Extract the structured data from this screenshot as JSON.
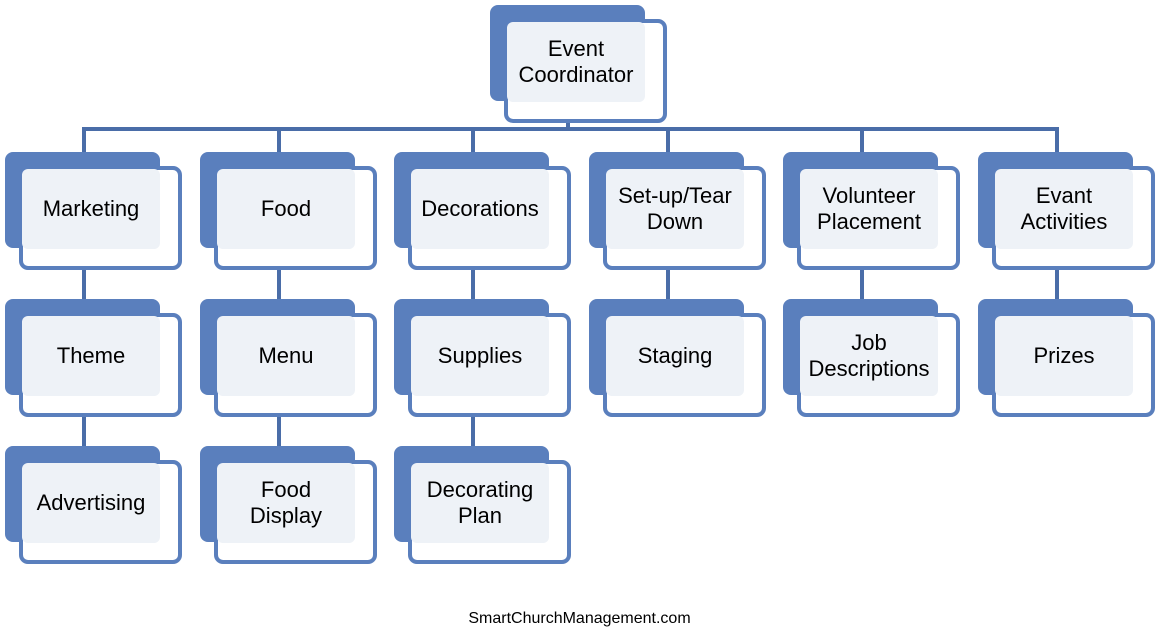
{
  "root": {
    "label": "Event\nCoordinator"
  },
  "columns": [
    {
      "items": [
        "Marketing",
        "Theme",
        "Advertising"
      ]
    },
    {
      "items": [
        "Food",
        "Menu",
        "Food\nDisplay"
      ]
    },
    {
      "items": [
        "Decorations",
        "Supplies",
        "Decorating\nPlan"
      ]
    },
    {
      "items": [
        "Set-up/Tear\nDown",
        "Staging"
      ]
    },
    {
      "items": [
        "Volunteer\nPlacement",
        "Job\nDescriptions"
      ]
    },
    {
      "items": [
        "Evant\nActivities",
        "Prizes"
      ]
    }
  ],
  "footer": "SmartChurchManagement.com",
  "colors": {
    "node_blue": "#5a7fbd",
    "connector": "#4a6da8",
    "fill": "#eef2f7"
  }
}
